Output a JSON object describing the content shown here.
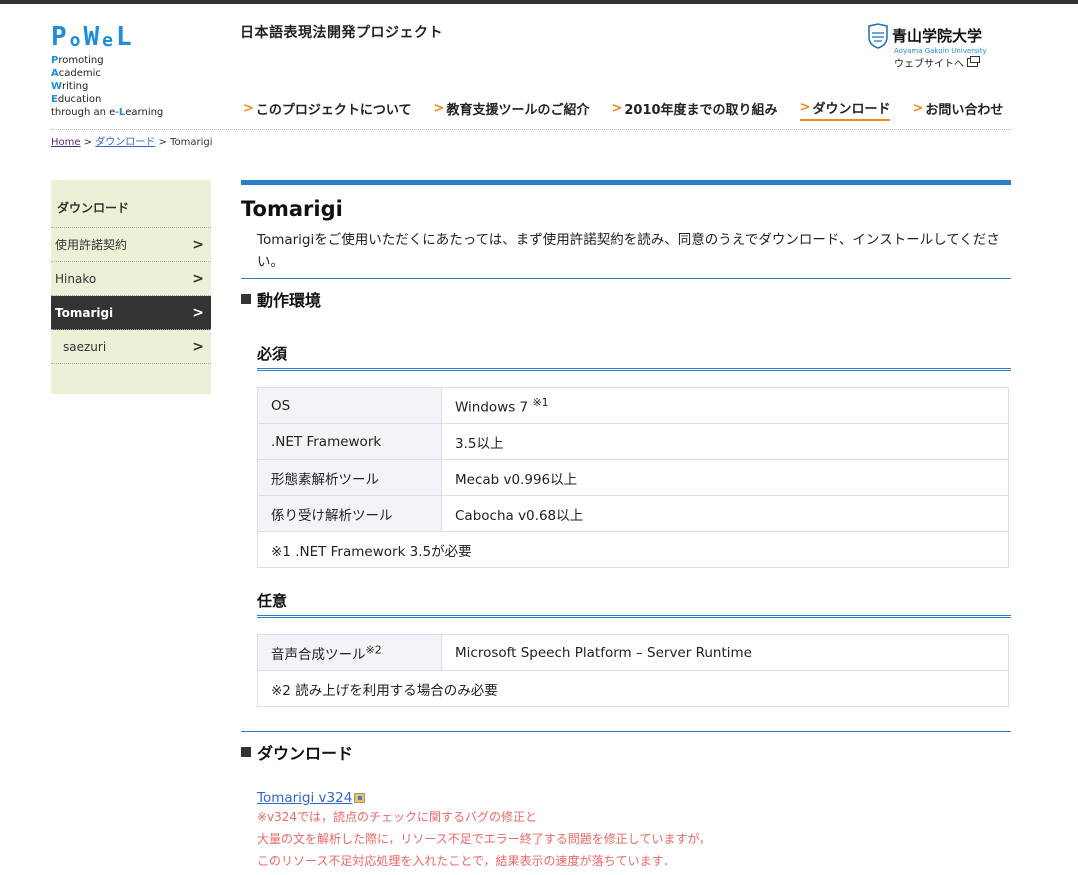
{
  "header": {
    "logo": {
      "mark": [
        "P",
        "o",
        "W",
        "e",
        "L"
      ],
      "lines": [
        {
          "initial": "P",
          "rest": "romoting"
        },
        {
          "initial": "A",
          "rest": "cademic"
        },
        {
          "initial": "W",
          "rest": "riting"
        },
        {
          "initial": "E",
          "rest": "ducation"
        },
        {
          "initial": "",
          "rest": "through an e-"
        },
        {
          "initial": "L",
          "rest": "earning"
        }
      ]
    },
    "project_title": "日本語表現法開発プロジェクト",
    "university": {
      "name": "青山学院大学",
      "name_en": "Aoyama Gakuin University",
      "link_label": "ウェブサイトへ"
    }
  },
  "gnav": [
    {
      "label": "このプロジェクトについて",
      "active": false
    },
    {
      "label": "教育支援ツールのご紹介",
      "active": false
    },
    {
      "label": "2010年度までの取り組み",
      "active": false
    },
    {
      "label": "ダウンロード",
      "active": true
    },
    {
      "label": "お問い合わせ",
      "active": false
    }
  ],
  "breadcrumb": {
    "home": "Home",
    "sep": ">",
    "parent": "ダウンロード",
    "current": "Tomarigi"
  },
  "sidebar": {
    "title": "ダウンロード",
    "items": [
      {
        "label": "使用許諾契約"
      },
      {
        "label": "Hinako"
      },
      {
        "label": "Tomarigi"
      },
      {
        "label": "saezuri"
      }
    ],
    "chevron": ">"
  },
  "main": {
    "title": "Tomarigi",
    "intro": "Tomarigiをご使用いただくにあたっては、まず使用許諾契約を読み、同意のうえでダウンロード、インストールしてください。",
    "section_env": "動作環境",
    "required": {
      "title": "必須",
      "rows": [
        {
          "label": "OS",
          "value": "Windows 7",
          "sup": "※1"
        },
        {
          "label": ".NET Framework",
          "value": "3.5以上"
        },
        {
          "label": "形態素解析ツール",
          "value": "Mecab v0.996以上"
        },
        {
          "label": "係り受け解析ツール",
          "value": "Cabocha v0.68以上"
        }
      ],
      "note": "※1 .NET Framework 3.5が必要"
    },
    "optional": {
      "title": "任意",
      "rows": [
        {
          "label": "音声合成ツール",
          "label_sup": "※2",
          "value": "Microsoft Speech Platform – Server Runtime"
        }
      ],
      "note": "※2 読み上げを利用する場合のみ必要"
    },
    "section_download": "ダウンロード",
    "download_link": "Tomarigi v324",
    "download_notes": [
      "※v324では，読点のチェックに関するバグの修正と",
      "大量の文を解析した際に，リソース不足でエラー終了する問題を修正していますが，",
      "このリソース不足対応処理を入れたことで，結果表示の速度が落ちています．"
    ]
  },
  "colors": {
    "accent_blue": "#2a7fc5",
    "nav_arrow": "#f08a1c",
    "sidebar_bg": "#eeefd7",
    "note_red": "#ee6666"
  }
}
